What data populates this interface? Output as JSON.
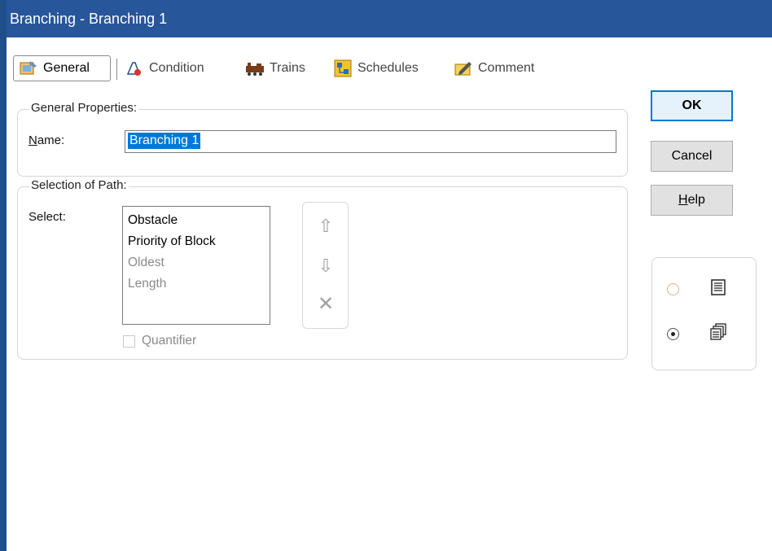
{
  "window": {
    "title": "Branching - Branching 1"
  },
  "tabs": [
    {
      "label": "General",
      "icon": "general-properties-icon",
      "active": true
    },
    {
      "label": "Condition",
      "icon": "condition-icon",
      "active": false
    },
    {
      "label": "Trains",
      "icon": "trains-icon",
      "active": false
    },
    {
      "label": "Schedules",
      "icon": "schedules-icon",
      "active": false
    },
    {
      "label": "Comment",
      "icon": "comment-icon",
      "active": false
    }
  ],
  "general_properties": {
    "title": "General Properties:",
    "name_label_underlined": "N",
    "name_label_rest": "ame:",
    "name_value": "Branching 1"
  },
  "selection_of_path": {
    "title": "Selection of Path:",
    "select_label": "Select:",
    "items": [
      {
        "label": "Obstacle",
        "enabled": true
      },
      {
        "label": "Priority of Block",
        "enabled": true
      },
      {
        "label": "Oldest",
        "enabled": false
      },
      {
        "label": "Length",
        "enabled": false
      }
    ],
    "quantifier_label": "Quantifier",
    "quantifier_checked": false
  },
  "buttons": {
    "ok": "OK",
    "cancel": "Cancel",
    "help_underlined": "H",
    "help_rest": "elp"
  },
  "view_mode": {
    "options": [
      {
        "icon": "single-list-icon",
        "selected": false
      },
      {
        "icon": "multiple-windows-icon",
        "selected": true
      }
    ]
  },
  "colors": {
    "titlebar": "#27569a",
    "selection": "#0078d7",
    "default_button_border": "#0078d7"
  }
}
